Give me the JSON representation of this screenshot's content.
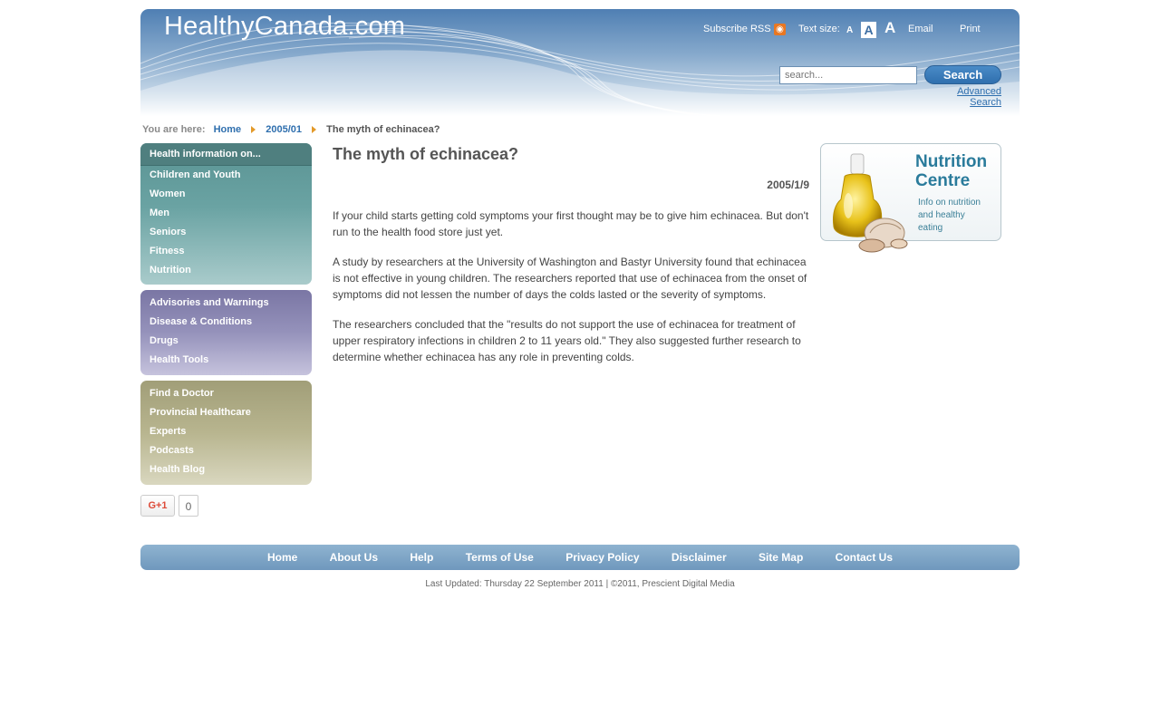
{
  "header": {
    "logo": "HealthyCanada.com",
    "subscribe_rss": "Subscribe RSS",
    "text_size_label": "Text size:",
    "text_size_small": "A",
    "text_size_medium": "A",
    "text_size_large": "A",
    "email": "Email",
    "print": "Print",
    "search_placeholder": "search...",
    "search_button": "Search",
    "advanced_search": "Advanced Search"
  },
  "breadcrumb": {
    "label": "You are here:",
    "items": [
      "Home",
      "2005/01"
    ],
    "current": "The myth of echinacea?"
  },
  "nav": {
    "group1_header": "Health information on...",
    "group1": [
      "Children and Youth",
      "Women",
      "Men",
      "Seniors",
      "Fitness",
      "Nutrition"
    ],
    "group2": [
      "Advisories and Warnings",
      "Disease & Conditions",
      "Drugs",
      "Health Tools"
    ],
    "group3": [
      "Find a Doctor",
      "Provincial Healthcare",
      "Experts",
      "Podcasts",
      "Health Blog"
    ]
  },
  "social": {
    "gplus_label": "G+1",
    "gplus_count": "0"
  },
  "article": {
    "title": "The myth of echinacea?",
    "date": "2005/1/9",
    "paragraphs": [
      "If your child starts getting cold symptoms your first thought may be to give him echinacea. But don't run to the health food store just yet.",
      "A study by researchers at the University of Washington and Bastyr University found that echinacea is not effective in young children. The researchers reported that use of echinacea from the onset of symptoms did not lessen the number of days the colds lasted or the severity of symptoms.",
      "The researchers concluded that the \"results do not support the use of echinacea for treatment of upper respiratory infections in children 2 to 11 years old.\" They also suggested further research to determine whether echinacea has any role in preventing colds."
    ]
  },
  "promo": {
    "title_line1": "Nutrition",
    "title_line2": "Centre",
    "sub_line1": "Info on nutrition",
    "sub_line2": "and healthy",
    "sub_line3": "eating"
  },
  "footer": {
    "links": [
      "Home",
      "About Us",
      "Help",
      "Terms of Use",
      "Privacy Policy",
      "Disclaimer",
      "Site Map",
      "Contact Us"
    ],
    "note": "Last Updated: Thursday 22 September 2011 | ©2011, Prescient Digital Media"
  },
  "colors": {
    "header_blue": "#4f7fb3",
    "link_blue": "#2f6fae",
    "nav_teal": "#6aa3a3",
    "nav_purple": "#9592bb",
    "nav_olive": "#b8b58f",
    "rss_orange": "#e87722"
  }
}
